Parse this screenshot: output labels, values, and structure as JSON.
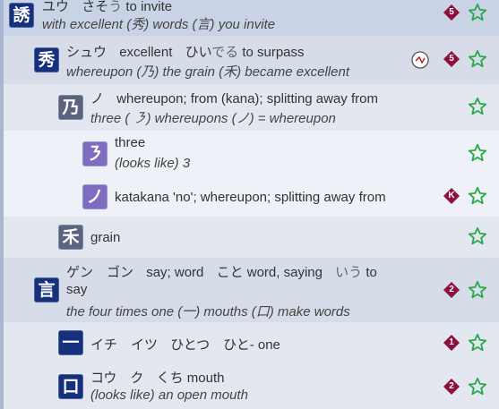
{
  "colors": {
    "star": "#2aa84a",
    "grade": "#8c0f3c",
    "navy": "#16307e",
    "violet": "#7d6cc0",
    "slate": "#5a6480"
  },
  "rows": [
    {
      "kanji": "誘",
      "on": "ユウ",
      "kun_stem": "さそ",
      "kun_okurigana": "う",
      "meaning": "to invite",
      "line2": "with excellent (秀) words (言) you invite",
      "grade": "5"
    },
    {
      "kanji": "秀",
      "on": "シュウ",
      "on_meaning": "excellent",
      "kun_stem": "ひい",
      "kun_okurigana": "でる",
      "meaning": "to surpass",
      "line2": "whereupon (乃) the grain (禾) became excellent",
      "grade": "5",
      "sound_icon": "sound-component-icon"
    },
    {
      "kanji": "乃",
      "on": "ノ",
      "meaning": "whereupon; from (kana); splitting away from",
      "line2": "three ( ㇋) whereupons (ノ) = whereupon"
    },
    {
      "kanji": "㇋",
      "meaning": "three",
      "line2": "(looks like) 3"
    },
    {
      "kanji": "ノ",
      "meaning": "katakana 'no'; whereupon; splitting away from",
      "grade": "K"
    },
    {
      "kanji": "禾",
      "meaning": "grain"
    },
    {
      "kanji": "言",
      "on": "ゲン　ゴン",
      "on_meaning": "say; word",
      "kun1": "こと",
      "kun1_meaning": "word, saying",
      "kun2": "いう",
      "kun2_meaning": "to",
      "meaning_cont": "say",
      "line2": "the four times one (一) mouths (口) make words",
      "grade": "2"
    },
    {
      "kanji": "一",
      "on": "イチ　イツ",
      "kun_stem": "ひとつ　ひと-",
      "meaning": "one",
      "grade": "1"
    },
    {
      "kanji": "口",
      "on": "コウ　ク",
      "kun_stem": "くち",
      "meaning": "mouth",
      "line2": "(looks like) an open mouth",
      "grade": "2"
    }
  ]
}
